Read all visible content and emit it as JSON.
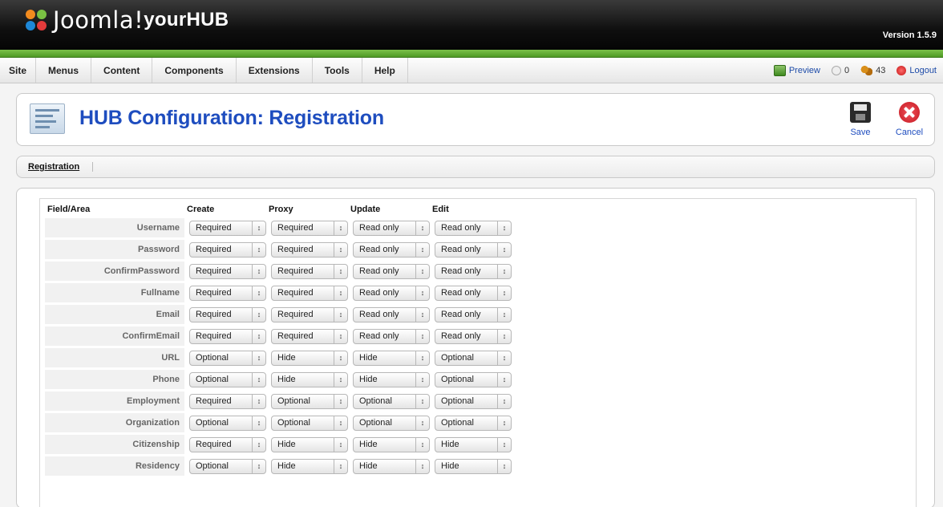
{
  "header": {
    "brand": "Joomla!",
    "subtitle": "yourHUB",
    "version": "Version 1.5.9"
  },
  "menubar": {
    "items": [
      "Site",
      "Menus",
      "Content",
      "Components",
      "Extensions",
      "Tools",
      "Help"
    ],
    "preview": "Preview",
    "messages": "0",
    "users": "43",
    "logout": "Logout"
  },
  "toolbar": {
    "title": "HUB Configuration: Registration",
    "save": "Save",
    "cancel": "Cancel"
  },
  "submenu": {
    "active": "Registration"
  },
  "table": {
    "columns": [
      "Field/Area",
      "Create",
      "Proxy",
      "Update",
      "Edit"
    ],
    "rows": [
      {
        "field": "Username",
        "values": [
          "Required",
          "Required",
          "Read only",
          "Read only"
        ]
      },
      {
        "field": "Password",
        "values": [
          "Required",
          "Required",
          "Read only",
          "Read only"
        ]
      },
      {
        "field": "ConfirmPassword",
        "values": [
          "Required",
          "Required",
          "Read only",
          "Read only"
        ]
      },
      {
        "field": "Fullname",
        "values": [
          "Required",
          "Required",
          "Read only",
          "Read only"
        ]
      },
      {
        "field": "Email",
        "values": [
          "Required",
          "Required",
          "Read only",
          "Read only"
        ]
      },
      {
        "field": "ConfirmEmail",
        "values": [
          "Required",
          "Required",
          "Read only",
          "Read only"
        ]
      },
      {
        "field": "URL",
        "values": [
          "Optional",
          "Hide",
          "Hide",
          "Optional"
        ]
      },
      {
        "field": "Phone",
        "values": [
          "Optional",
          "Hide",
          "Hide",
          "Optional"
        ]
      },
      {
        "field": "Employment",
        "values": [
          "Required",
          "Optional",
          "Optional",
          "Optional"
        ]
      },
      {
        "field": "Organization",
        "values": [
          "Optional",
          "Optional",
          "Optional",
          "Optional"
        ]
      },
      {
        "field": "Citizenship",
        "values": [
          "Required",
          "Hide",
          "Hide",
          "Hide"
        ]
      },
      {
        "field": "Residency",
        "values": [
          "Optional",
          "Hide",
          "Hide",
          "Hide"
        ]
      }
    ]
  },
  "colors": {
    "title_blue": "#1e4dbf",
    "green_bar": "#5ca52e"
  }
}
